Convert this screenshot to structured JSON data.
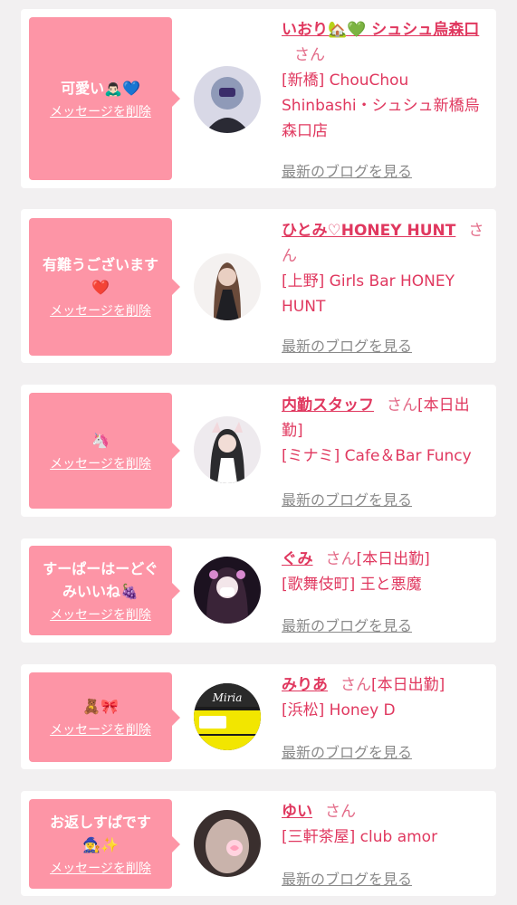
{
  "messages": [
    {
      "message": "可愛い🙇🏻‍♂️💙",
      "delete_label": "メッセージを削除",
      "name": "いおり🏡💚 シュシュ烏森口",
      "honorific": "さん",
      "status": "",
      "shop": "[新橋] ChouChou Shinbashi・シュシュ新橋烏森口店",
      "blog_label": "最新のブログを見る"
    },
    {
      "message": "有難うございます❤️",
      "delete_label": "メッセージを削除",
      "name": "ひとみ♡HONEY HUNT",
      "honorific": "さん",
      "status": "",
      "shop": "[上野] Girls Bar HONEY HUNT",
      "blog_label": "最新のブログを見る"
    },
    {
      "message": "🦄",
      "delete_label": "メッセージを削除",
      "name": "内勤スタッフ",
      "honorific": "さん",
      "status": "[本日出勤]",
      "shop": "[ミナミ] Cafe＆Bar Funcy",
      "blog_label": "最新のブログを見る"
    },
    {
      "message": "すーぱーはーどぐみいいね🍇",
      "delete_label": "メッセージを削除",
      "name": "ぐみ",
      "honorific": "さん",
      "status": "[本日出勤]",
      "shop": "[歌舞伎町] 王と悪魔",
      "blog_label": "最新のブログを見る"
    },
    {
      "message": "🧸🎀",
      "delete_label": "メッセージを削除",
      "name": "みりあ",
      "honorific": "さん",
      "status": "[本日出勤]",
      "shop": "[浜松] Honey D",
      "blog_label": "最新のブログを見る"
    },
    {
      "message": "お返しすぱです🧙‍♀️✨",
      "delete_label": "メッセージを削除",
      "name": "ゆい",
      "honorific": "さん",
      "status": "",
      "shop": "[三軒茶屋] club amor",
      "blog_label": "最新のブログを見る"
    }
  ],
  "colors": {
    "bubble": "#fd95a6",
    "accent_text": "#e0385f",
    "muted_link": "#8a8a8a",
    "background": "#f2f0f1"
  },
  "icons": [
    "profile-photo-avatar",
    "speech-bubble-tail"
  ]
}
